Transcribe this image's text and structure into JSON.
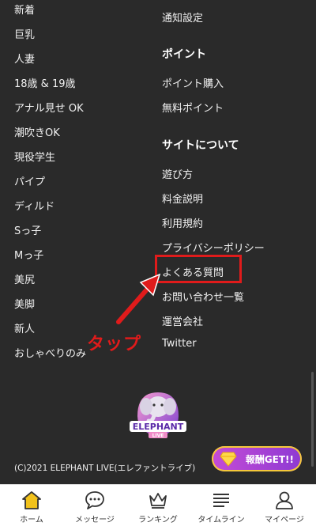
{
  "left_menu": {
    "items": [
      "新着",
      "巨乳",
      "人妻",
      "18歳 & 19歳",
      "アナル見せ OK",
      "潮吹きOK",
      "現役学生",
      "パイプ",
      "ディルド",
      "Sっ子",
      "Mっ子",
      "美尻",
      "美脚",
      "新人",
      "おしゃべりのみ"
    ]
  },
  "right_menu": {
    "top_item": "通知設定",
    "point_heading": "ポイント",
    "point_items": [
      "ポイント購入",
      "無料ポイント"
    ],
    "site_heading": "サイトについて",
    "site_items": [
      "遊び方",
      "料金説明",
      "利用規約",
      "プライバシーポリシー",
      "よくある質問",
      "お問い合わせ一覧",
      "運営会社",
      "Twitter"
    ]
  },
  "annotation": {
    "tap_label": "タップ",
    "color": "#e01b1b"
  },
  "logo": {
    "name": "ELEPHANT",
    "sub": "LIVE"
  },
  "footer": {
    "copyright": "(C)2021 ELEPHANT LIVE(エレファントライブ)"
  },
  "reward_button": {
    "label": "報酬GET!!"
  },
  "tabbar": {
    "tabs": [
      {
        "label": "ホーム",
        "icon": "home-icon"
      },
      {
        "label": "メッセージ",
        "icon": "chat-icon"
      },
      {
        "label": "ランキング",
        "icon": "crown-icon"
      },
      {
        "label": "タイムライン",
        "icon": "timeline-icon"
      },
      {
        "label": "マイページ",
        "icon": "user-icon"
      }
    ]
  },
  "colors": {
    "background": "#2a2a2a",
    "text": "#f2f2f2",
    "home_icon": "#f2c21b",
    "accent_purple": "#8e3ad3"
  }
}
